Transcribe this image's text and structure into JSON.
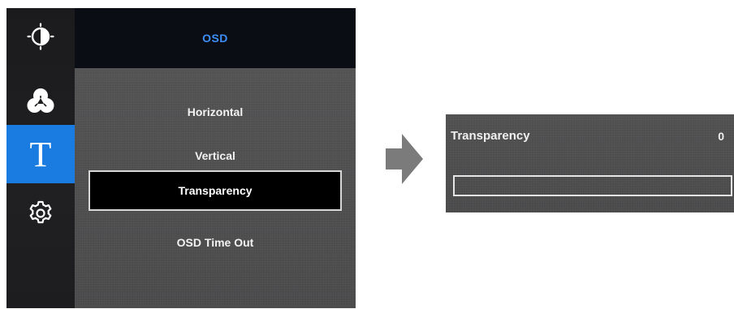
{
  "osd_menu": {
    "header_title": "OSD",
    "sidebar": [
      {
        "icon": "brightness-icon",
        "active": false
      },
      {
        "icon": "color-icon",
        "active": false
      },
      {
        "icon": "text-t-icon",
        "glyph": "T",
        "active": true
      },
      {
        "icon": "settings-gear-icon",
        "active": false
      }
    ],
    "items": [
      {
        "label": "Horizontal"
      },
      {
        "label": "Vertical"
      },
      {
        "label": "Transparency",
        "selected": true
      },
      {
        "label": "OSD Time Out"
      }
    ],
    "colors": {
      "active_tab": "#1a7be0",
      "header_text": "#3e8ef7"
    }
  },
  "arrow": {
    "icon": "arrow-right-icon"
  },
  "submenu": {
    "label": "Transparency",
    "value": "0",
    "slider_fraction": 0.0
  }
}
